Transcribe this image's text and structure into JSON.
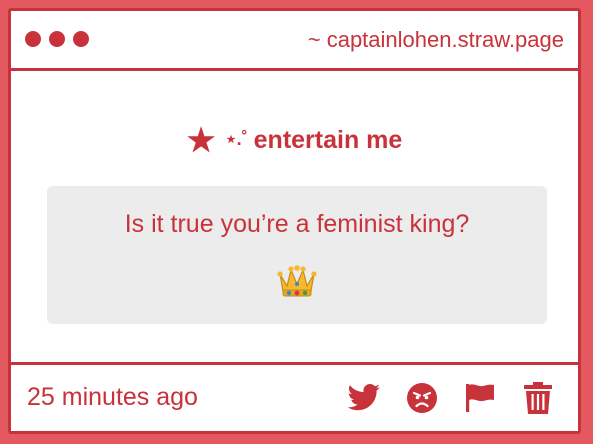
{
  "window": {
    "url": "~ captainlohen.straw.page"
  },
  "prompt": {
    "star": "★",
    "sparkle": "⋆.˚",
    "text": "entertain me"
  },
  "question": {
    "text": "Is it true you’re a feminist king?",
    "emoji_icon": "crown-icon"
  },
  "footer": {
    "timestamp": "25 minutes ago",
    "actions": [
      {
        "icon": "twitter-bird-icon"
      },
      {
        "icon": "angry-face-icon"
      },
      {
        "icon": "flag-icon"
      },
      {
        "icon": "trash-icon"
      }
    ]
  },
  "colors": {
    "accent": "#c8323a",
    "background": "#e4585f",
    "card": "#ffffff",
    "question_box": "#ececec"
  }
}
